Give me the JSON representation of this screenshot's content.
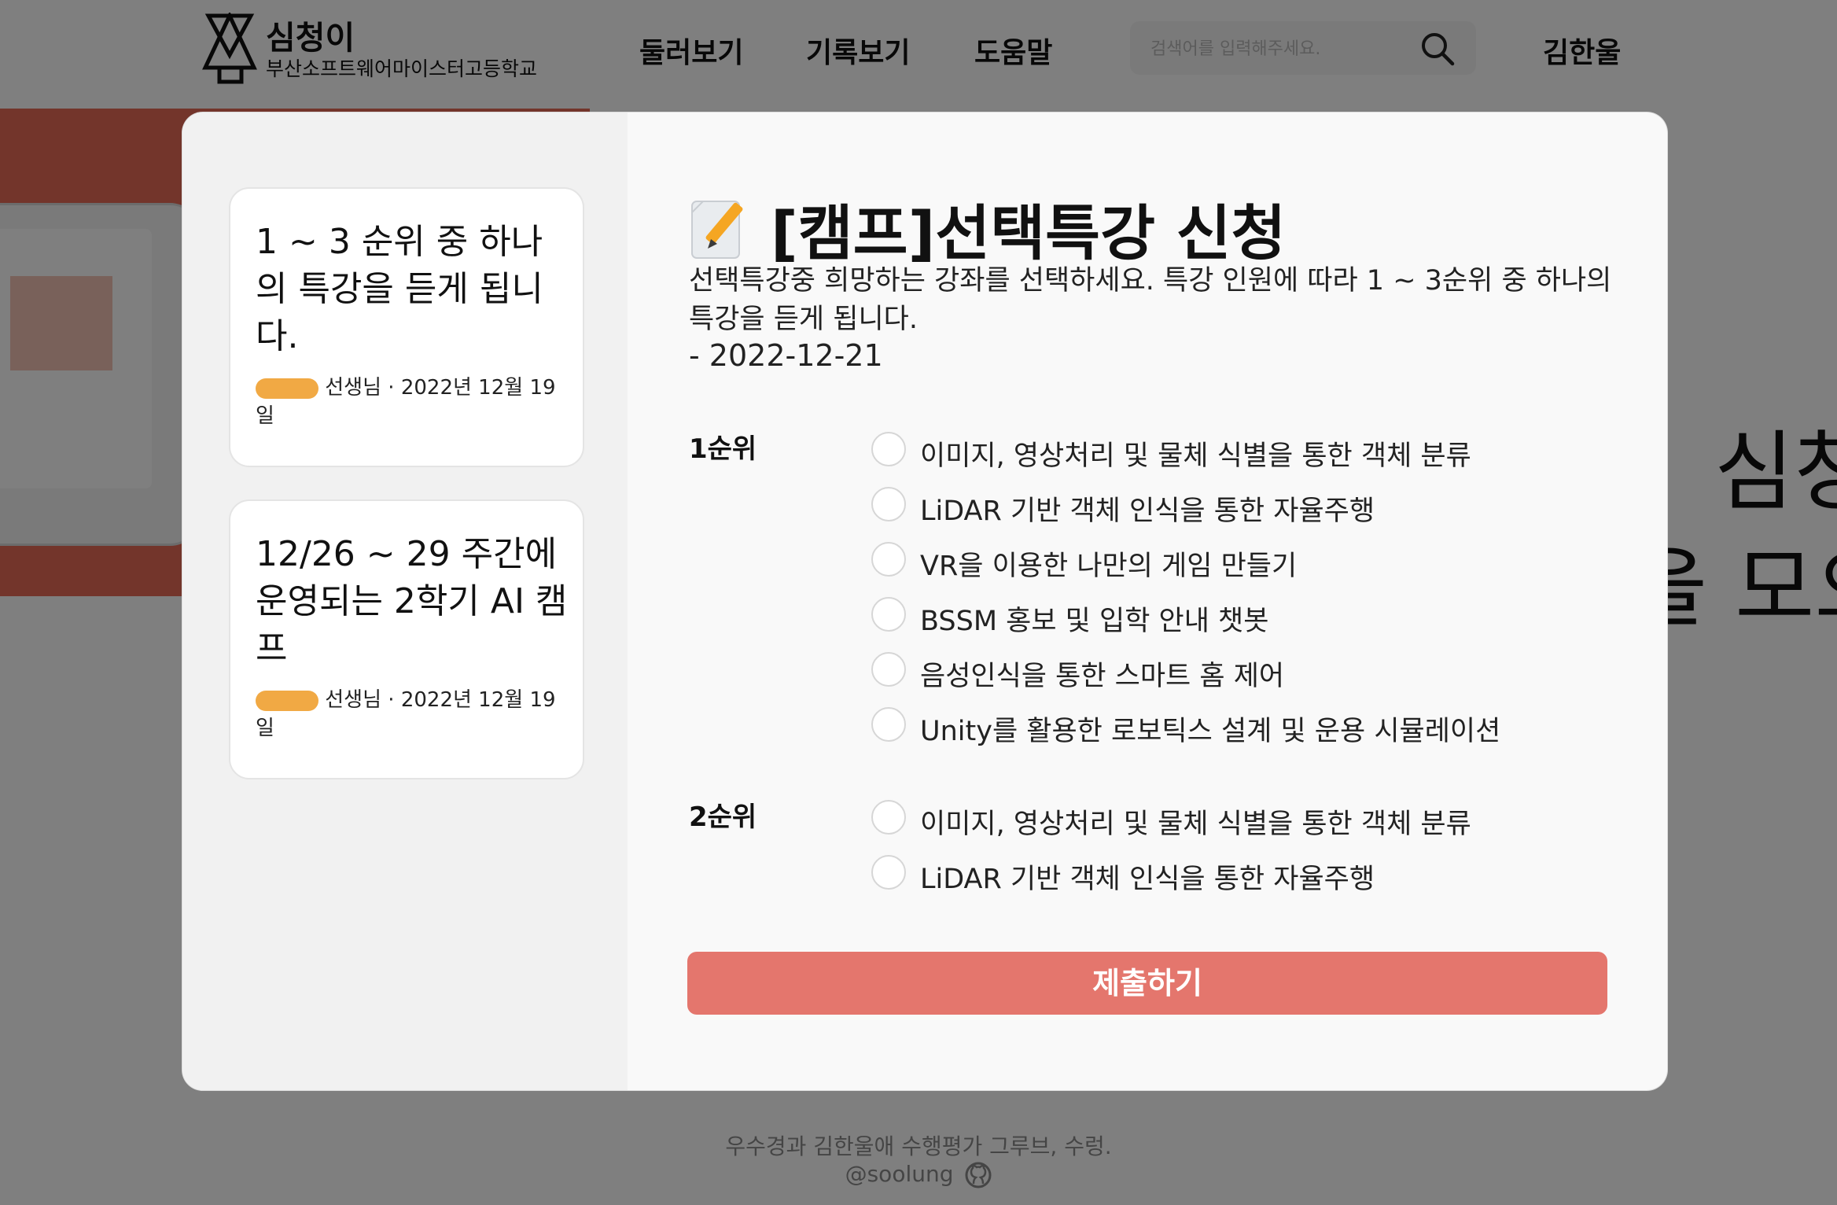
{
  "header": {
    "logo_name": "심청이",
    "logo_sub": "부산소프트웨어마이스터고등학교",
    "nav": [
      "둘러보기",
      "기록보기",
      "도움말"
    ],
    "search_placeholder": "검색어를 입력해주세요.",
    "user_name": "김한울"
  },
  "hero": {
    "big_text_1": "심청",
    "big_text_2": "을 모으"
  },
  "sidebar": {
    "cards": [
      {
        "title": "1 ~ 3 순위 중 하나의 특강을 듣게 됩니다.",
        "meta": "선생님 · 2022년 12월 19일"
      },
      {
        "title": "12/26 ~ 29 주간에 운영되는 2학기 AI 캠프",
        "meta": "선생님 · 2022년 12월 19일"
      }
    ]
  },
  "form": {
    "title": "[캠프]선택특강 신청",
    "description": "선택특강중 희망하는 강좌를 선택하세요. 특강 인원에 따라 1 ~ 3순위 중 하나의 특강을 듣게 됩니다.",
    "date": "- 2022-12-21",
    "rank1_label": "1순위",
    "rank1_options": [
      "이미지, 영상처리 및 물체 식별을 통한 객체 분류",
      "LiDAR 기반 객체 인식을 통한 자율주행",
      "VR을 이용한 나만의 게임 만들기",
      "BSSM 홍보 및 입학 안내 챗봇",
      "음성인식을 통한 스마트 홈 제어",
      "Unity를 활용한 로보틱스 설계 및 운용 시뮬레이션"
    ],
    "rank2_label": "2순위",
    "rank2_options": [
      "이미지, 영상처리 및 물체 식별을 통한 객체 분류",
      "LiDAR 기반 객체 인식을 통한 자율주행"
    ],
    "submit_label": "제출하기"
  },
  "footer": {
    "credit": "우수경과 김한울애 수행평가 그루브, 수렁.",
    "handle": "@soolung"
  },
  "colors": {
    "accent": "#e4766d",
    "hero_red": "#e66a57"
  }
}
